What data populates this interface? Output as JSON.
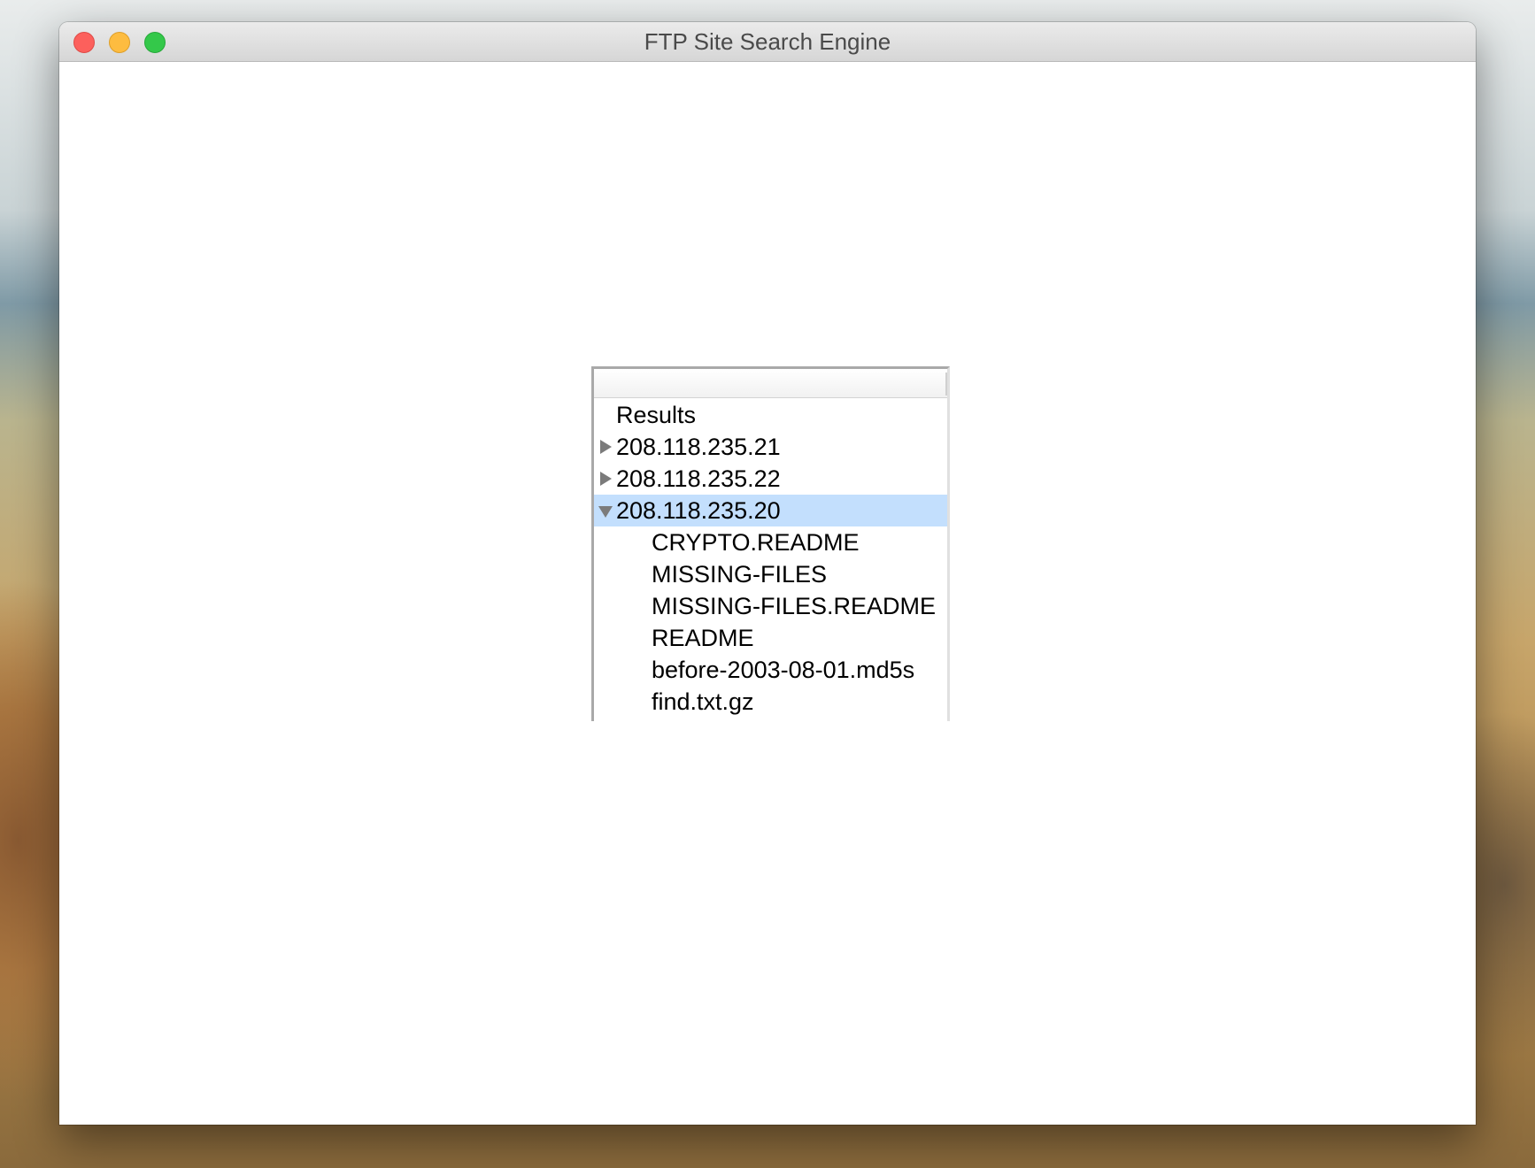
{
  "window": {
    "title": "FTP Site Search Engine"
  },
  "tree": {
    "root_label": "Results",
    "nodes": [
      {
        "label": "208.118.235.21",
        "expanded": false
      },
      {
        "label": "208.118.235.22",
        "expanded": false
      },
      {
        "label": "208.118.235.20",
        "expanded": true,
        "selected": true,
        "children": [
          "CRYPTO.README",
          "MISSING-FILES",
          "MISSING-FILES.README",
          "README",
          "before-2003-08-01.md5s",
          "find.txt.gz"
        ]
      }
    ]
  },
  "colors": {
    "selection": "#c3dffd",
    "close": "#fc605c",
    "minimize": "#fdbc40",
    "maximize": "#34c84a"
  }
}
